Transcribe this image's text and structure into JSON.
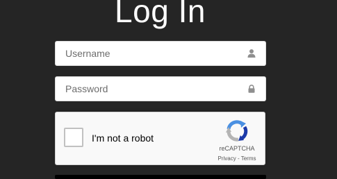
{
  "title": "Log In",
  "username": {
    "placeholder": "Username",
    "value": "",
    "icon": "user-icon"
  },
  "password": {
    "placeholder": "Password",
    "value": "",
    "icon": "lock-icon"
  },
  "recaptcha": {
    "label": "I'm not a robot",
    "checked": false,
    "brand": "reCAPTCHA",
    "privacy_label": "Privacy",
    "separator": " - ",
    "terms_label": "Terms",
    "logo_icon": "recaptcha-logo-icon"
  },
  "colors": {
    "background": "#252525",
    "title": "#ffffff",
    "field_bg": "#ffffff",
    "captcha_bg": "#f9f9f9",
    "icon_gray": "#8f8f8f",
    "recaptcha_blue": "#4a90e2",
    "recaptcha_dark_blue": "#1c3aa9",
    "recaptcha_gray": "#b4b4b4"
  }
}
